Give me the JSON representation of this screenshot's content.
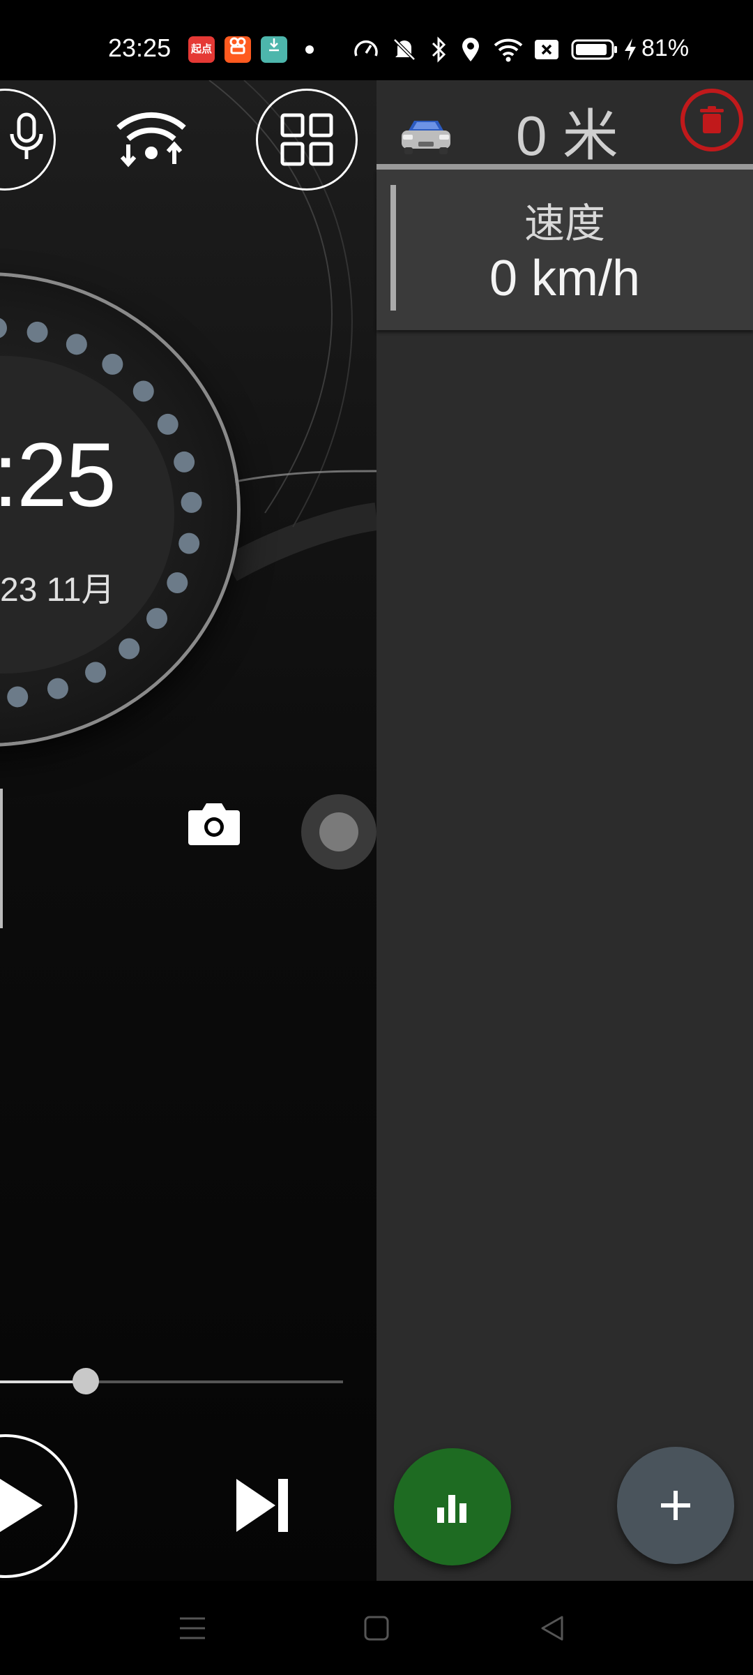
{
  "status_bar": {
    "time": "23:25",
    "apps": [
      {
        "icon": "qidian-app-icon",
        "label": "起点",
        "color": "#e53935"
      },
      {
        "icon": "kuaishou-app-icon",
        "label": "",
        "color": "#ff5a1f"
      },
      {
        "icon": "download-app-icon",
        "label": "",
        "color": "#4db6ac"
      }
    ],
    "icons": [
      "speed-icon",
      "mute-icon",
      "bluetooth-icon",
      "location-icon",
      "wifi-icon",
      "sim-off-icon",
      "battery-icon",
      "charging-icon"
    ],
    "battery": "81%"
  },
  "left_panel": {
    "buttons": [
      "mic-icon",
      "wifi-transfer-icon",
      "grid-apps-icon"
    ],
    "clock": {
      "time": ":25",
      "date": "23 11月"
    },
    "seek_progress": 0.25,
    "controls": [
      "camera-icon",
      "record-dot-icon",
      "play-icon",
      "skip-next-icon"
    ]
  },
  "right_panel": {
    "distance": "0 米",
    "card": {
      "label": "速度",
      "value": "0 km/h"
    },
    "colors": {
      "delete": "#d32f2f",
      "stats_fab": "#1e6b22",
      "add_fab": "#4a545c"
    }
  },
  "nav_bar": {
    "items": [
      "menu-icon",
      "home-icon",
      "back-icon"
    ]
  }
}
